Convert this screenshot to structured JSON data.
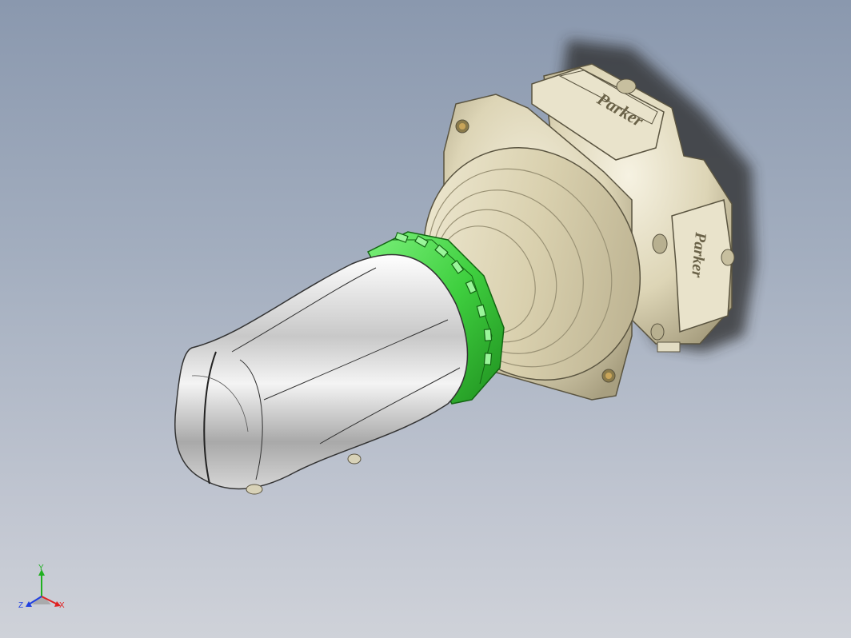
{
  "viewport": {
    "background_top": "#8a98ae",
    "background_bottom": "#cfd2d9"
  },
  "model": {
    "body_color": "#e2dcc3",
    "ring_color": "#4fd84f",
    "handle_color": "#d8d8d8",
    "logo_text": "Parker"
  },
  "triad": {
    "x_label": "X",
    "y_label": "Y",
    "z_label": "Z",
    "x_color": "#e02020",
    "y_color": "#20b020",
    "z_color": "#2040e0"
  }
}
